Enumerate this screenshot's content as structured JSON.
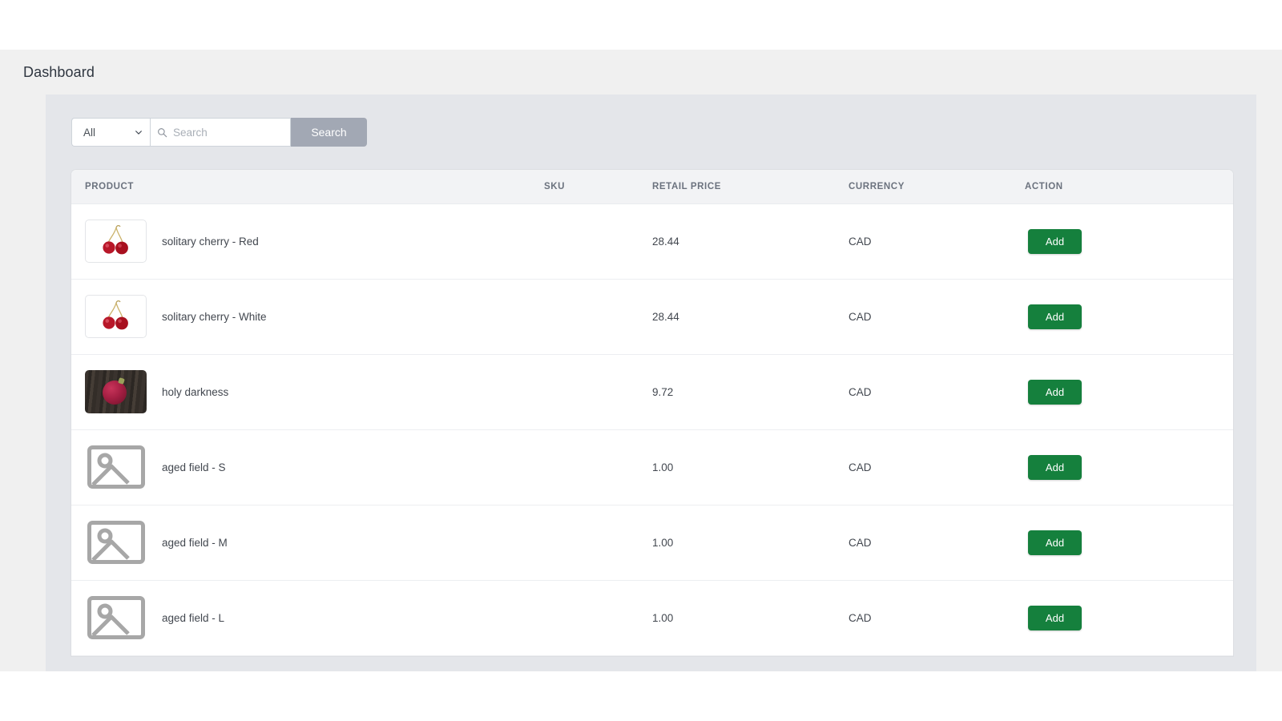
{
  "header": {
    "title": "Dashboard"
  },
  "search": {
    "category_selected": "All",
    "category_options": [
      "All"
    ],
    "placeholder": "Search",
    "value": "",
    "button_label": "Search",
    "search_icon": "search-icon",
    "chevron_icon": "chevron-down-icon",
    "button_color": "#a2a8b4"
  },
  "table": {
    "columns": [
      "PRODUCT",
      "SKU",
      "RETAIL PRICE",
      "CURRENCY",
      "ACTION"
    ],
    "action_label": "Add",
    "action_color": "#15803d",
    "rows": [
      {
        "thumb": "cherry-image",
        "name": "solitary cherry - Red",
        "sku": "",
        "price": "28.44",
        "currency": "CAD",
        "action": "Add"
      },
      {
        "thumb": "cherry-image",
        "name": "solitary cherry - White",
        "sku": "",
        "price": "28.44",
        "currency": "CAD",
        "action": "Add"
      },
      {
        "thumb": "berry-on-wood-image",
        "name": "holy darkness",
        "sku": "",
        "price": "9.72",
        "currency": "CAD",
        "action": "Add"
      },
      {
        "thumb": "image-placeholder-icon",
        "name": "aged field - S",
        "sku": "",
        "price": "1.00",
        "currency": "CAD",
        "action": "Add"
      },
      {
        "thumb": "image-placeholder-icon",
        "name": "aged field - M",
        "sku": "",
        "price": "1.00",
        "currency": "CAD",
        "action": "Add"
      },
      {
        "thumb": "image-placeholder-icon",
        "name": "aged field - L",
        "sku": "",
        "price": "1.00",
        "currency": "CAD",
        "action": "Add"
      }
    ]
  }
}
